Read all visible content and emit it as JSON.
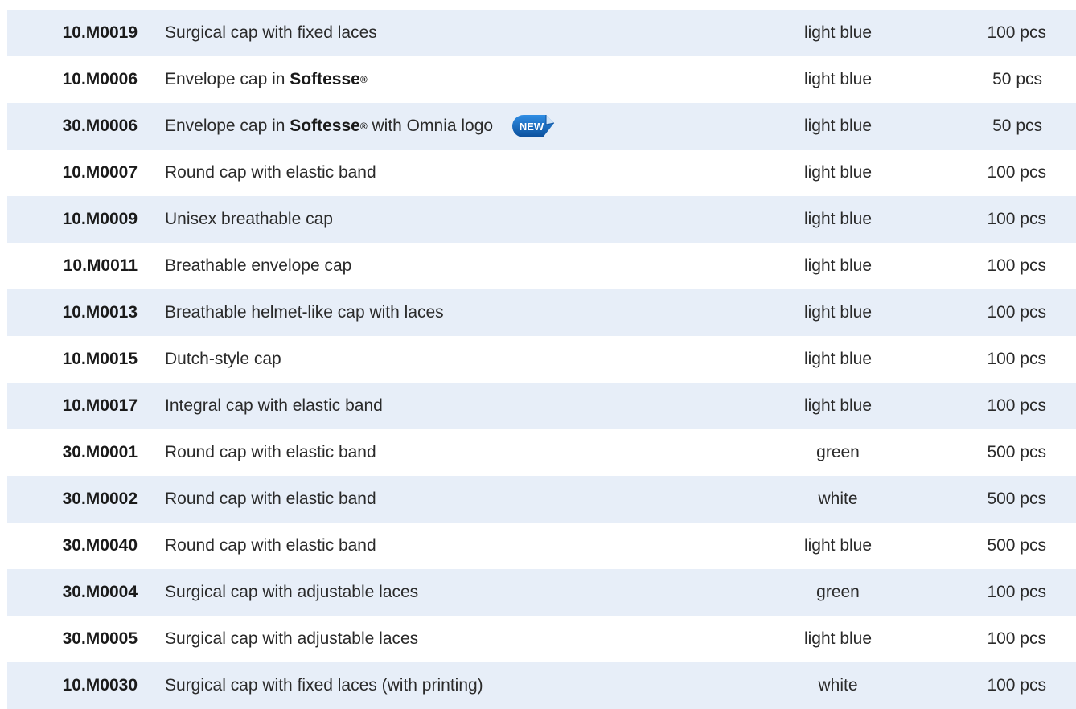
{
  "rows": [
    {
      "code": "10.M0019",
      "desc": "Surgical cap with fixed laces",
      "color": "light blue",
      "qty": "100 pcs"
    },
    {
      "code": "10.M0006",
      "desc_pre": "Envelope cap in ",
      "desc_brand": "Softesse",
      "desc_reg": "®",
      "color": "light blue",
      "qty": "50 pcs"
    },
    {
      "code": "30.M0006",
      "desc_pre": "Envelope cap in ",
      "desc_brand": "Softesse",
      "desc_reg": "®",
      "desc_post": " with Omnia logo",
      "badge": "NEW",
      "color": "light blue",
      "qty": "50 pcs"
    },
    {
      "code": "10.M0007",
      "desc": "Round cap with elastic band",
      "color": "light blue",
      "qty": "100 pcs"
    },
    {
      "code": "10.M0009",
      "desc": "Unisex breathable cap",
      "color": "light blue",
      "qty": "100 pcs"
    },
    {
      "code": "10.M0011",
      "desc": "Breathable envelope cap",
      "color": "light blue",
      "qty": "100 pcs"
    },
    {
      "code": "10.M0013",
      "desc": "Breathable helmet-like cap with laces",
      "color": "light blue",
      "qty": "100 pcs"
    },
    {
      "code": "10.M0015",
      "desc": "Dutch-style cap",
      "color": "light blue",
      "qty": "100 pcs"
    },
    {
      "code": "10.M0017",
      "desc": "Integral cap with elastic band",
      "color": "light blue",
      "qty": "100 pcs"
    },
    {
      "code": "30.M0001",
      "desc": "Round cap with elastic band",
      "color": "green",
      "qty": "500 pcs"
    },
    {
      "code": "30.M0002",
      "desc": "Round cap with elastic band",
      "color": "white",
      "qty": "500 pcs"
    },
    {
      "code": "30.M0040",
      "desc": "Round cap with elastic band",
      "color": "light blue",
      "qty": "500 pcs"
    },
    {
      "code": "30.M0004",
      "desc": "Surgical cap with adjustable laces",
      "color": "green",
      "qty": "100 pcs"
    },
    {
      "code": "30.M0005",
      "desc": "Surgical cap with adjustable laces",
      "color": "light blue",
      "qty": "100 pcs"
    },
    {
      "code": "10.M0030",
      "desc": "Surgical cap with fixed laces (with printing)",
      "color": "white",
      "qty": "100 pcs"
    }
  ],
  "colors": {
    "shaded_row": "#e7eef8",
    "text": "#2a2a2a",
    "badge_blue": "#1565c0"
  },
  "icons": {
    "new_badge": "new-badge-icon"
  }
}
